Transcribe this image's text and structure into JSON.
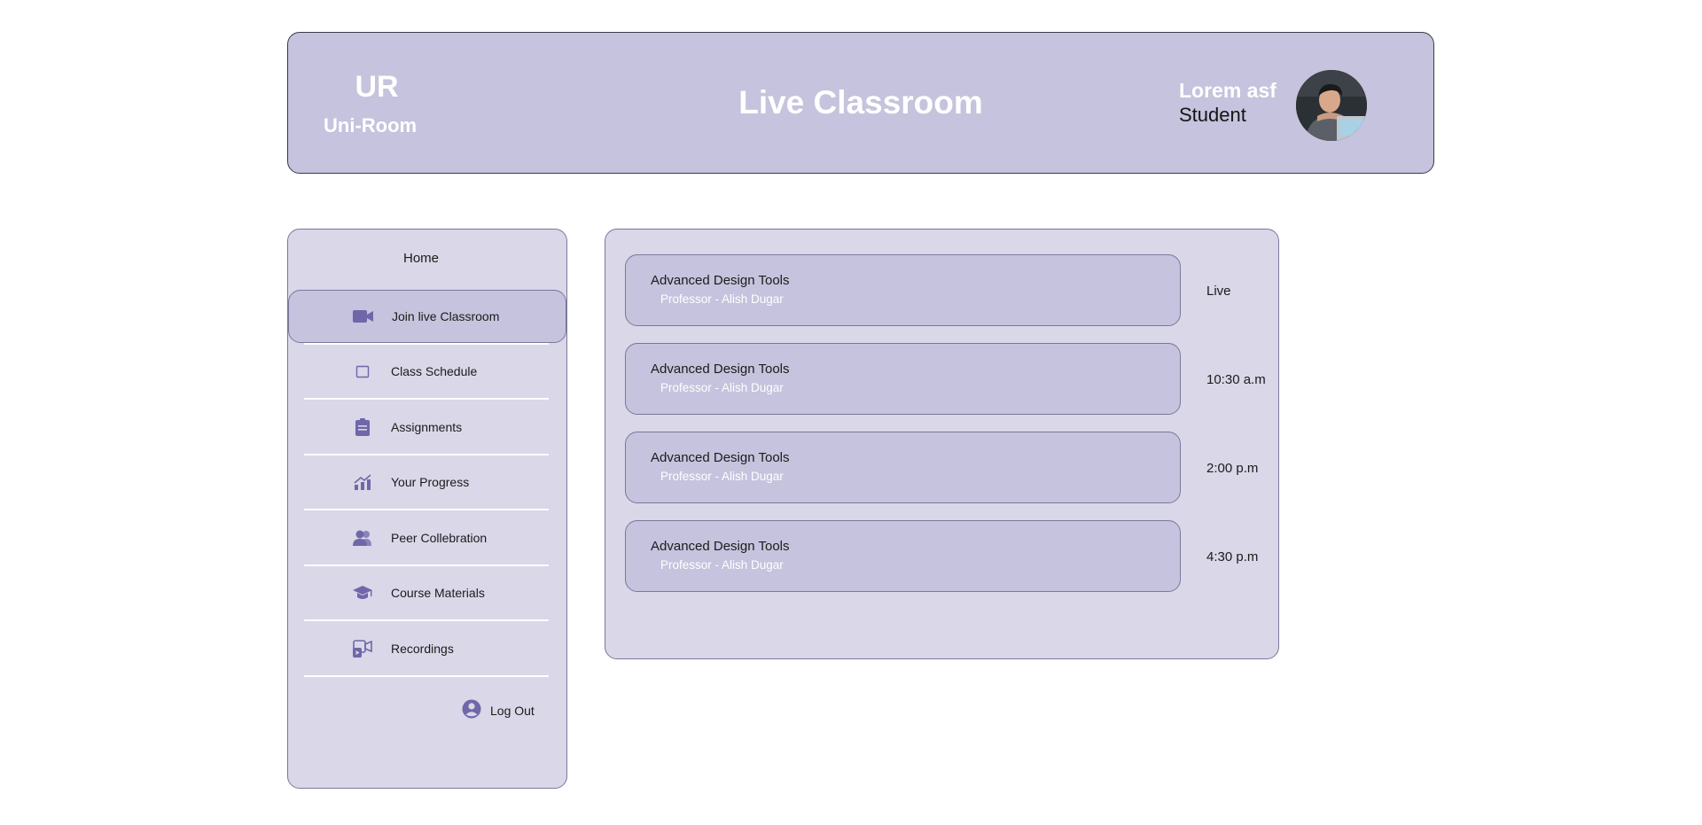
{
  "header": {
    "logo_abbr": "UR",
    "logo_name": "Uni-Room",
    "page_title": "Live Classroom",
    "user_name": "Lorem asf",
    "user_role": "Student"
  },
  "sidebar": {
    "home_label": "Home",
    "items": [
      {
        "label": "Join live Classroom",
        "icon": "video-camera-icon",
        "active": true
      },
      {
        "label": "Class Schedule",
        "icon": "calendar-icon",
        "active": false
      },
      {
        "label": "Assignments",
        "icon": "clipboard-icon",
        "active": false
      },
      {
        "label": "Your Progress",
        "icon": "chart-icon",
        "active": false
      },
      {
        "label": "Peer Collebration",
        "icon": "people-icon",
        "active": false
      },
      {
        "label": "Course Materials",
        "icon": "graduation-cap-icon",
        "active": false
      },
      {
        "label": "Recordings",
        "icon": "recording-icon",
        "active": false
      }
    ],
    "logout_label": "Log Out"
  },
  "classes": [
    {
      "name": "Advanced Design Tools",
      "professor": "Professor - Alish Dugar",
      "time": "Live"
    },
    {
      "name": "Advanced Design Tools",
      "professor": "Professor - Alish Dugar",
      "time": "10:30 a.m"
    },
    {
      "name": "Advanced Design Tools",
      "professor": "Professor - Alish Dugar",
      "time": "2:00 p.m"
    },
    {
      "name": "Advanced Design Tools",
      "professor": "Professor - Alish Dugar",
      "time": "4:30 p.m"
    }
  ],
  "colors": {
    "panel_bg": "#c5c3dd",
    "panel_light_bg": "#d9d7e8",
    "icon_accent": "#6f67a8"
  }
}
